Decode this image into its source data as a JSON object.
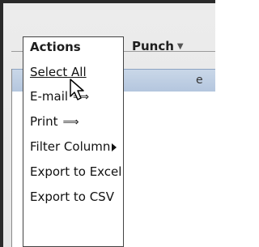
{
  "tabs": {
    "actions": "Actions",
    "punch": "Punch"
  },
  "grid": {
    "header_fragment": "e"
  },
  "menu": {
    "items": [
      {
        "label": "Select All"
      },
      {
        "label": "E-mail"
      },
      {
        "label": "Print"
      },
      {
        "label": "Filter Column"
      },
      {
        "label": "Export to Excel"
      },
      {
        "label": "Export to CSV"
      }
    ]
  },
  "glyphs": {
    "dbl_arrow": "⟹",
    "dropdown": "▼"
  }
}
